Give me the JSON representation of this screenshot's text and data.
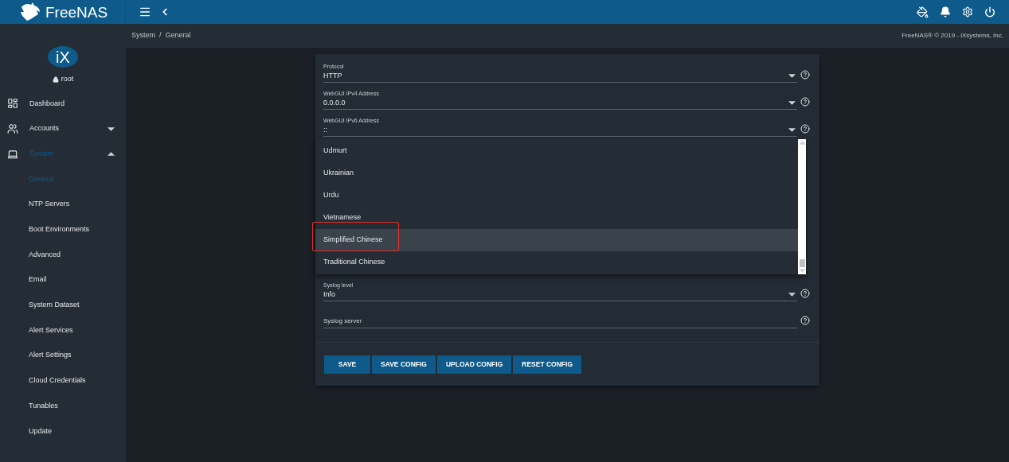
{
  "topbar": {
    "brand": "FreeNAS"
  },
  "sidebar": {
    "logo": "iX",
    "user": "root",
    "items": [
      {
        "label": "Dashboard",
        "selected": false
      },
      {
        "label": "Accounts",
        "selected": false,
        "expanded": false
      },
      {
        "label": "System",
        "selected": true,
        "expanded": true,
        "children": [
          {
            "label": "General",
            "selected": true
          },
          {
            "label": "NTP Servers",
            "selected": false
          },
          {
            "label": "Boot Environments",
            "selected": false
          },
          {
            "label": "Advanced",
            "selected": false
          },
          {
            "label": "Email",
            "selected": false
          },
          {
            "label": "System Dataset",
            "selected": false
          },
          {
            "label": "Alert Services",
            "selected": false
          },
          {
            "label": "Alert Settings",
            "selected": false
          },
          {
            "label": "Cloud Credentials",
            "selected": false
          },
          {
            "label": "Tunables",
            "selected": false
          },
          {
            "label": "Update",
            "selected": false
          }
        ]
      }
    ]
  },
  "breadcrumb": [
    "System",
    "/",
    "General"
  ],
  "copyright": "FreeNAS® © 2019 - iXsystems, Inc.",
  "form": {
    "fields_top": [
      {
        "kind": "select",
        "label": "Protocol",
        "value": "HTTP"
      },
      {
        "kind": "select",
        "label": "WebGUI IPv4 Address",
        "value": "0.0.0.0"
      },
      {
        "kind": "select",
        "label": "WebGUI IPv6 Address",
        "value": "::"
      }
    ],
    "dropdown": {
      "options": [
        {
          "label": "Udmurt",
          "selected": false,
          "marked": false
        },
        {
          "label": "Ukrainian",
          "selected": false,
          "marked": false
        },
        {
          "label": "Urdu",
          "selected": false,
          "marked": false
        },
        {
          "label": "Vietnamese",
          "selected": false,
          "marked": false
        },
        {
          "label": "Simplified Chinese",
          "selected": true,
          "marked": true
        },
        {
          "label": "Traditional Chinese",
          "selected": false,
          "marked": false
        }
      ]
    },
    "fields_bottom": [
      {
        "kind": "select",
        "label": "Syslog level",
        "value": "Info"
      },
      {
        "kind": "text",
        "placeholder": "Syslog server"
      }
    ],
    "buttons": [
      "SAVE",
      "SAVE CONFIG",
      "UPLOAD CONFIG",
      "RESET CONFIG"
    ]
  }
}
